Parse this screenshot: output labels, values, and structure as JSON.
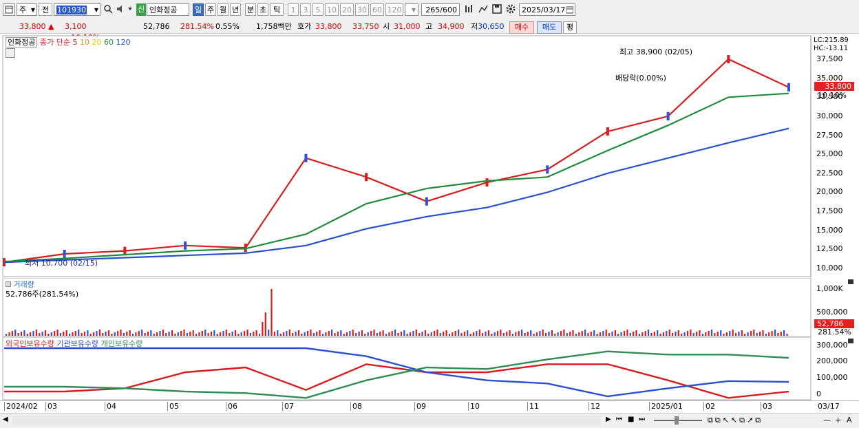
{
  "toolbar": {
    "market": "주",
    "prev_label": "전",
    "code": "101930",
    "badge": "신",
    "stock_name": "인화정공",
    "periods": [
      "일",
      "주",
      "월",
      "년",
      "분",
      "초",
      "틱"
    ],
    "active_period": "일",
    "ranges": [
      "1",
      "3",
      "5",
      "10",
      "20",
      "30",
      "60",
      "120"
    ],
    "count": "265",
    "count_max": "/600",
    "date": "2025/03/17"
  },
  "quote": {
    "price": "33,800",
    "change": "3,100 +10.10%",
    "volume": "52,786",
    "volume_ratio": "281.54%",
    "turnover": "0.55%",
    "amount": "1,758백만",
    "ask_label": "호가",
    "ask": "33,800",
    "bid": "33,750",
    "open_label": "시",
    "open": "31,000",
    "high_label": "고",
    "high": "34,900",
    "low_label": "저",
    "low": "30,650",
    "buy_label": "매수",
    "sell_label": "매도",
    "eval_label": "평"
  },
  "price_pane": {
    "name": "인화정공",
    "legend_prefix": "종가 단순",
    "ma_periods": [
      "5",
      "10",
      "20",
      "60",
      "120"
    ],
    "ma_colors": [
      "#d81c1c",
      "#f08a1c",
      "#f2e030",
      "#1f8c3a",
      "#2850d0"
    ],
    "lc": "LC:215.89",
    "hc": "HC:-13.11",
    "current_price": "33,800",
    "current_pct": "10.10%",
    "max_annot": "최고 38,900 (02/05)",
    "min_annot": "최저 10,700 (02/15)",
    "dividend_annot": "배당락(0.00%)",
    "y_ticks": [
      "37,500",
      "35,000",
      "32,500",
      "30,000",
      "27,500",
      "25,000",
      "22,500",
      "20,000",
      "17,500",
      "15,000",
      "12,500",
      "10,000"
    ]
  },
  "volume_pane": {
    "title": "거래량",
    "value": "52,786주(281.54%)",
    "y_ticks": [
      "1,000K",
      "500,000"
    ],
    "current": "52,786",
    "current_pct": "281.54%"
  },
  "holding_pane": {
    "legends": [
      "외국인보유수량",
      "기관보유수량",
      "개인보유수량"
    ],
    "legend_colors": [
      "#d81c1c",
      "#2850d0",
      "#2f8c55"
    ],
    "y_ticks": [
      "300,000",
      "200,000",
      "100,000",
      "0"
    ]
  },
  "x_axis": {
    "labels": [
      "2024/02",
      "03",
      "04",
      "05",
      "06",
      "07",
      "08",
      "09",
      "10",
      "11",
      "12",
      "2025/01",
      "02",
      "03",
      "03/17"
    ]
  },
  "chart_data": {
    "type": "line",
    "title": "",
    "x": [
      "2024/02",
      "03",
      "04",
      "05",
      "06",
      "07",
      "08",
      "09",
      "10",
      "11",
      "12",
      "2025/01",
      "02",
      "03"
    ],
    "series": [
      {
        "name": "종가",
        "values": [
          10800,
          11900,
          12300,
          13000,
          12700,
          24500,
          22000,
          18800,
          21300,
          23000,
          28000,
          30000,
          37500,
          33800
        ]
      },
      {
        "name": "60",
        "values": [
          10900,
          11300,
          11800,
          12300,
          12600,
          14500,
          18500,
          20500,
          21500,
          22000,
          25500,
          28800,
          32500,
          33000
        ]
      },
      {
        "name": "120",
        "values": [
          10800,
          11100,
          11400,
          11700,
          12000,
          13000,
          15200,
          16800,
          18000,
          20000,
          22500,
          24500,
          26500,
          28400
        ]
      },
      {
        "name": "외국인보유수량",
        "values": [
          30000,
          30000,
          50000,
          150000,
          180000,
          40000,
          200000,
          150000,
          150000,
          200000,
          200000,
          100000,
          -10000,
          30000
        ]
      },
      {
        "name": "기관보유수량",
        "values": [
          300000,
          300000,
          300000,
          300000,
          300000,
          300000,
          250000,
          150000,
          100000,
          80000,
          0,
          50000,
          95000,
          90000
        ]
      },
      {
        "name": "개인보유수량",
        "values": [
          60000,
          60000,
          50000,
          30000,
          20000,
          -10000,
          100000,
          180000,
          170000,
          230000,
          280000,
          260000,
          260000,
          240000
        ]
      }
    ],
    "ylim": [
      9000,
      40000
    ]
  }
}
